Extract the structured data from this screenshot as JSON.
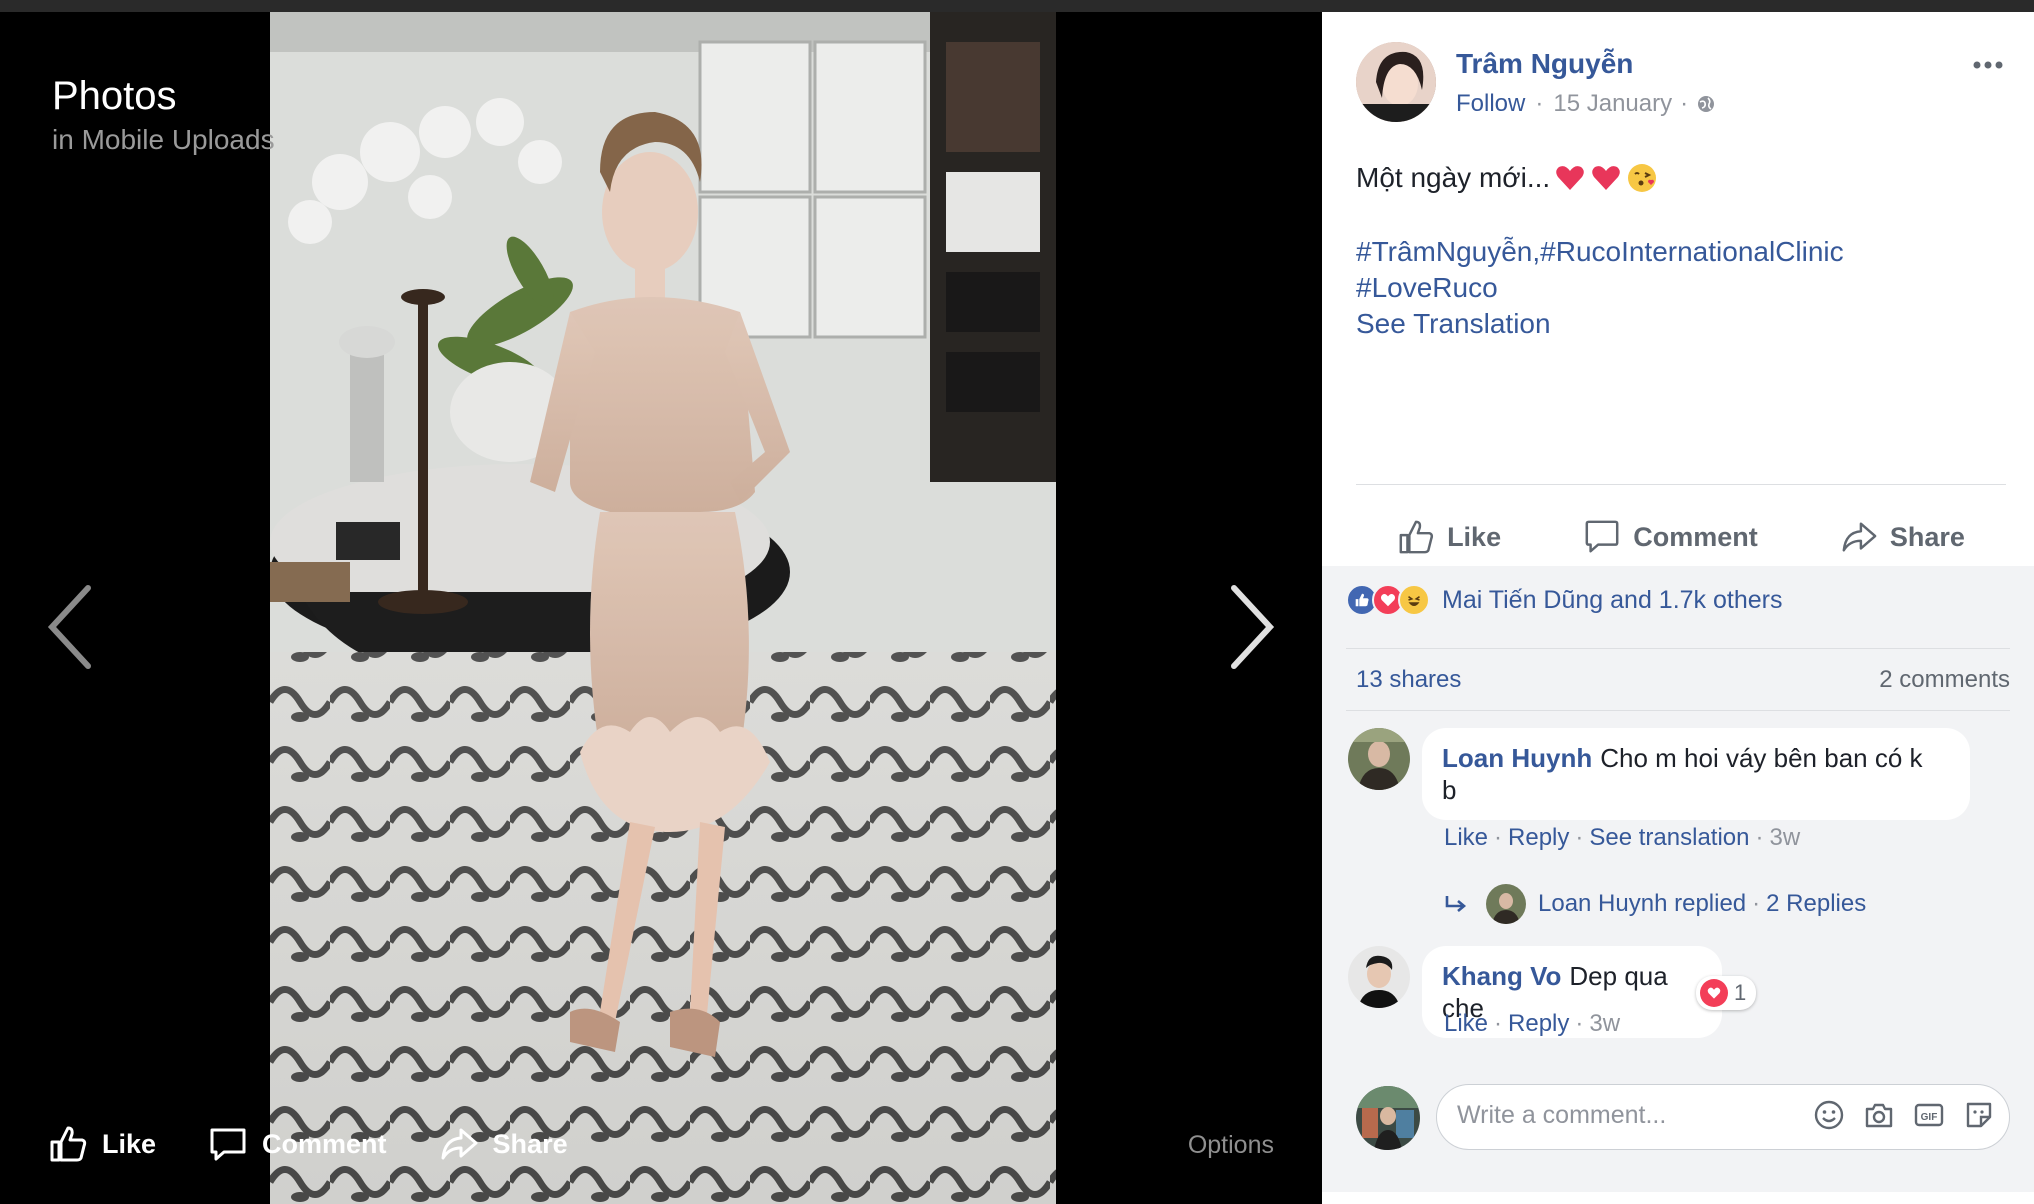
{
  "viewer": {
    "title": "Photos",
    "subtitle": "in Mobile Uploads",
    "actions": {
      "like": "Like",
      "comment": "Comment",
      "share": "Share"
    },
    "options": "Options"
  },
  "post": {
    "author": "Trâm Nguyễn",
    "follow": "Follow",
    "date": "15 January",
    "separator": "·",
    "text": "Một ngày mới...",
    "hashtags_line1": "#TrâmNguyễn,#RucoInternationalClinic",
    "hashtags_line2": "#LoveRuco",
    "see_translation": "See Translation"
  },
  "actions": {
    "like": "Like",
    "comment": "Comment",
    "share": "Share"
  },
  "reactions": {
    "icons": [
      "like-icon",
      "love-icon",
      "haha-icon"
    ],
    "text": "Mai Tiến Dũng and 1.7k others",
    "shares": "13 shares",
    "comments": "2 comments"
  },
  "comments": [
    {
      "name": "Loan Huynh",
      "text_line1": "Cho m hoi váy bên ban có k",
      "text_line2": "b",
      "like": "Like",
      "reply": "Reply",
      "see_translation": "See translation",
      "time": "3w",
      "replies_author": "Loan Huynh replied",
      "replies_count": "2 Replies"
    },
    {
      "name": "Khang Vo",
      "text": "Dep qua che",
      "reaction_count": "1",
      "like": "Like",
      "reply": "Reply",
      "time": "3w"
    }
  ],
  "write_comment": {
    "placeholder": "Write a comment..."
  },
  "colors": {
    "link": "#365899",
    "meta": "#90949c",
    "panel_grey": "#f2f3f5",
    "love": "#f33e58",
    "like_blue": "#4267b2"
  }
}
